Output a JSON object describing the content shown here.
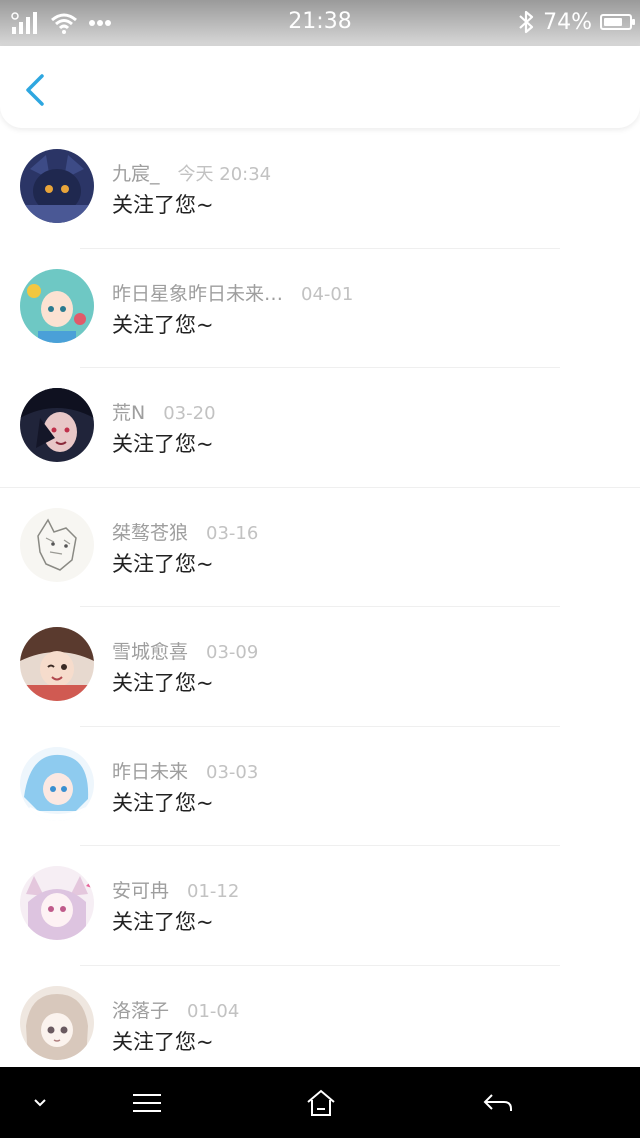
{
  "status_bar": {
    "time": "21:38",
    "battery": "74%",
    "battery_level": 0.74,
    "icons": [
      "signal-icon",
      "wifi-icon",
      "more-dots-icon",
      "bluetooth-icon",
      "battery-icon"
    ]
  },
  "header": {
    "back_icon": "chevron-left-icon",
    "accent_color": "#2ea7e0"
  },
  "notifications": [
    {
      "name": "九宸_",
      "time": "今天 20:34",
      "message": "关注了您~"
    },
    {
      "name": "昨日星象昨日未来…",
      "time": "04-01",
      "message": "关注了您~"
    },
    {
      "name": "荒N",
      "time": "03-20",
      "message": "关注了您~"
    },
    {
      "name": "桀骜苍狼",
      "time": "03-16",
      "message": "关注了您~"
    },
    {
      "name": "雪城愈喜",
      "time": "03-09",
      "message": "关注了您~"
    },
    {
      "name": "昨日未来",
      "time": "03-03",
      "message": "关注了您~"
    },
    {
      "name": "安可冉",
      "time": "01-12",
      "message": "关注了您~"
    },
    {
      "name": "洛落子",
      "time": "01-04",
      "message": "关注了您~"
    }
  ],
  "nav_bar": {
    "icons": [
      "chevron-down-icon",
      "menu-icon",
      "home-icon",
      "return-icon"
    ]
  }
}
